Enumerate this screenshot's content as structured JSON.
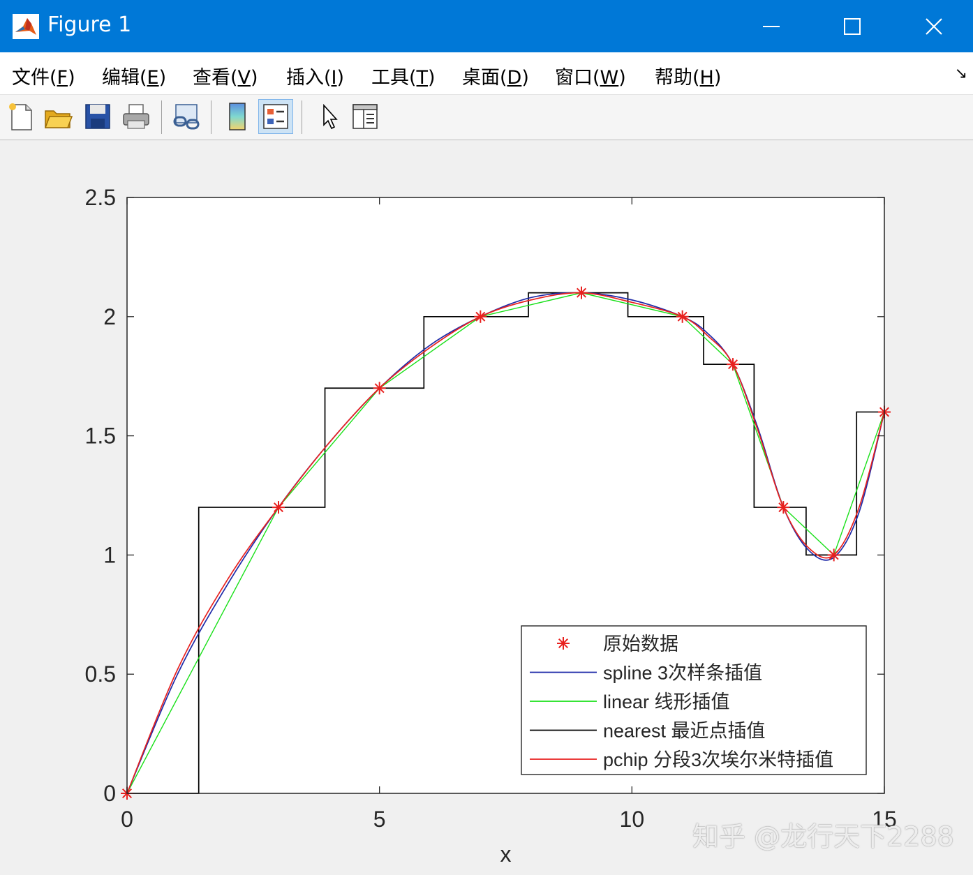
{
  "window": {
    "title": "Figure 1",
    "controls": {
      "minimize": "—",
      "maximize": "☐",
      "close": "✕"
    }
  },
  "menu": {
    "items": [
      {
        "text": "文件(",
        "acc": "F",
        "end": ")"
      },
      {
        "text": "编辑(",
        "acc": "E",
        "end": ")"
      },
      {
        "text": "查看(",
        "acc": "V",
        "end": ")"
      },
      {
        "text": "插入(",
        "acc": "I",
        "end": ")"
      },
      {
        "text": "工具(",
        "acc": "T",
        "end": ")"
      },
      {
        "text": "桌面(",
        "acc": "D",
        "end": ")"
      },
      {
        "text": "窗口(",
        "acc": "W",
        "end": ")"
      },
      {
        "text": "帮助(",
        "acc": "H",
        "end": ")"
      }
    ],
    "dock_glyph": "↘"
  },
  "toolbar": {
    "buttons": [
      "new-figure-icon",
      "open-file-icon",
      "save-icon",
      "print-icon",
      "link-plot-icon",
      "colorbar-icon",
      "legend-icon",
      "edit-pointer-icon",
      "property-editor-icon"
    ],
    "active": "legend-icon"
  },
  "watermark": "知乎 @龙行天下2288",
  "chart_data": {
    "type": "line",
    "xlabel": "x",
    "ylabel": "",
    "xlim": [
      0,
      15
    ],
    "ylim": [
      0,
      2.5
    ],
    "xticks": [
      0,
      5,
      10,
      15
    ],
    "yticks": [
      0,
      0.5,
      1,
      1.5,
      2,
      2.5
    ],
    "x_tick_labels": [
      "0",
      "5",
      "10",
      "15"
    ],
    "y_tick_labels": [
      "0",
      "0.5",
      "1",
      "1.5",
      "2",
      "2.5"
    ],
    "grid": false,
    "legend_position": "bottom-right",
    "colors": {
      "data": "#e8211f",
      "spline": "#1f2aa8",
      "linear": "#19e019",
      "nearest": "#000000",
      "pchip": "#e8211f"
    },
    "series": [
      {
        "name": "原始数据",
        "style": "markers",
        "x": [
          0,
          3,
          5,
          7,
          9,
          11,
          12,
          13,
          14,
          15
        ],
        "y": [
          0,
          1.2,
          1.7,
          2.0,
          2.1,
          2.0,
          1.8,
          1.2,
          1.0,
          1.6
        ]
      },
      {
        "name": "spline 3次样条插值",
        "style": "line",
        "x": [
          0,
          1,
          2,
          3,
          4,
          5,
          6,
          7,
          8,
          9,
          10,
          11,
          11.5,
          12,
          12.5,
          13,
          13.5,
          14,
          14.5,
          15
        ],
        "y": [
          0,
          0.5,
          0.88,
          1.2,
          1.47,
          1.7,
          1.88,
          2.0,
          2.08,
          2.1,
          2.07,
          2.0,
          1.93,
          1.8,
          1.53,
          1.2,
          1.02,
          0.99,
          1.18,
          1.6
        ]
      },
      {
        "name": "linear 线形插值",
        "style": "line",
        "x": [
          0,
          3,
          5,
          7,
          9,
          11,
          12,
          13,
          14,
          15
        ],
        "y": [
          0,
          1.2,
          1.7,
          2.0,
          2.1,
          2.0,
          1.8,
          1.2,
          1.0,
          1.6
        ]
      },
      {
        "name": "nearest 最近点插值",
        "style": "step",
        "x": [
          0,
          1.42,
          1.42,
          3.92,
          3.92,
          5.88,
          5.88,
          7.95,
          7.95,
          9.92,
          9.92,
          11.42,
          11.42,
          12.42,
          12.42,
          13.45,
          13.45,
          14.45,
          14.45,
          15
        ],
        "y": [
          0,
          0,
          1.2,
          1.2,
          1.7,
          1.7,
          2.0,
          2.0,
          2.1,
          2.1,
          2.0,
          2.0,
          1.8,
          1.8,
          1.2,
          1.2,
          1.0,
          1.0,
          1.6,
          1.6
        ]
      },
      {
        "name": "pchip 分段3次埃尔米特插值",
        "style": "line",
        "x": [
          0,
          1,
          2,
          3,
          4,
          5,
          6,
          7,
          8,
          9,
          10,
          11,
          11.5,
          12,
          12.5,
          13,
          13.5,
          14,
          14.5,
          15
        ],
        "y": [
          0,
          0.52,
          0.9,
          1.2,
          1.47,
          1.7,
          1.87,
          2.0,
          2.07,
          2.1,
          2.06,
          2.0,
          1.92,
          1.8,
          1.52,
          1.2,
          1.03,
          1.0,
          1.2,
          1.6
        ]
      }
    ]
  }
}
